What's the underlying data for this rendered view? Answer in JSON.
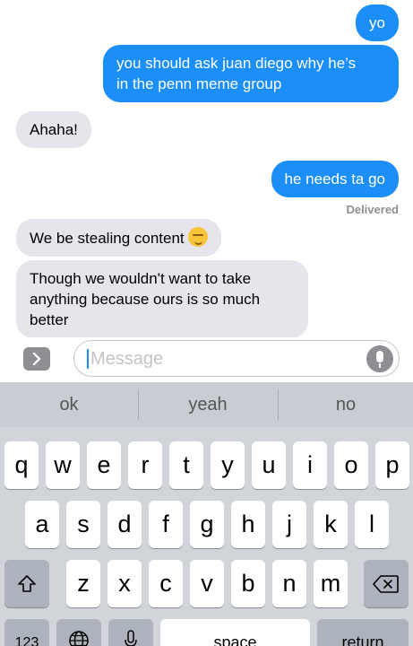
{
  "messages": [
    {
      "text": "yo",
      "side": "sent"
    },
    {
      "line1": "you should ask juan diego why he’s",
      "line2": "in the penn meme group",
      "side": "sent"
    },
    {
      "text": "Ahaha!",
      "side": "received"
    },
    {
      "text": "he needs ta go",
      "side": "sent"
    },
    {
      "text": "We be stealing content",
      "side": "received",
      "emoji": "smirking-face"
    },
    {
      "line1": "Though we wouldn't want to take",
      "line2": "anything because ours is so much",
      "line3": "better",
      "side": "received"
    }
  ],
  "status": {
    "delivered": "Delivered"
  },
  "composer": {
    "apps_icon": "chevron-right-icon",
    "placeholder": "Message",
    "mic_icon": "microphone-icon"
  },
  "suggestions": [
    "ok",
    "yeah",
    "no"
  ],
  "keyboard": {
    "row1": [
      "q",
      "w",
      "e",
      "r",
      "t",
      "y",
      "u",
      "i",
      "o",
      "p"
    ],
    "row2": [
      "a",
      "s",
      "d",
      "f",
      "g",
      "h",
      "j",
      "k",
      "l"
    ],
    "row3": [
      "z",
      "x",
      "c",
      "v",
      "b",
      "n",
      "m"
    ],
    "bottom": {
      "numbers": "123",
      "space": "space",
      "return": "return"
    }
  },
  "colors": {
    "sent_bubble": "#1b8ef8",
    "received_bubble": "#e6e5eb",
    "keyboard_bg": "#d1d4d9"
  }
}
